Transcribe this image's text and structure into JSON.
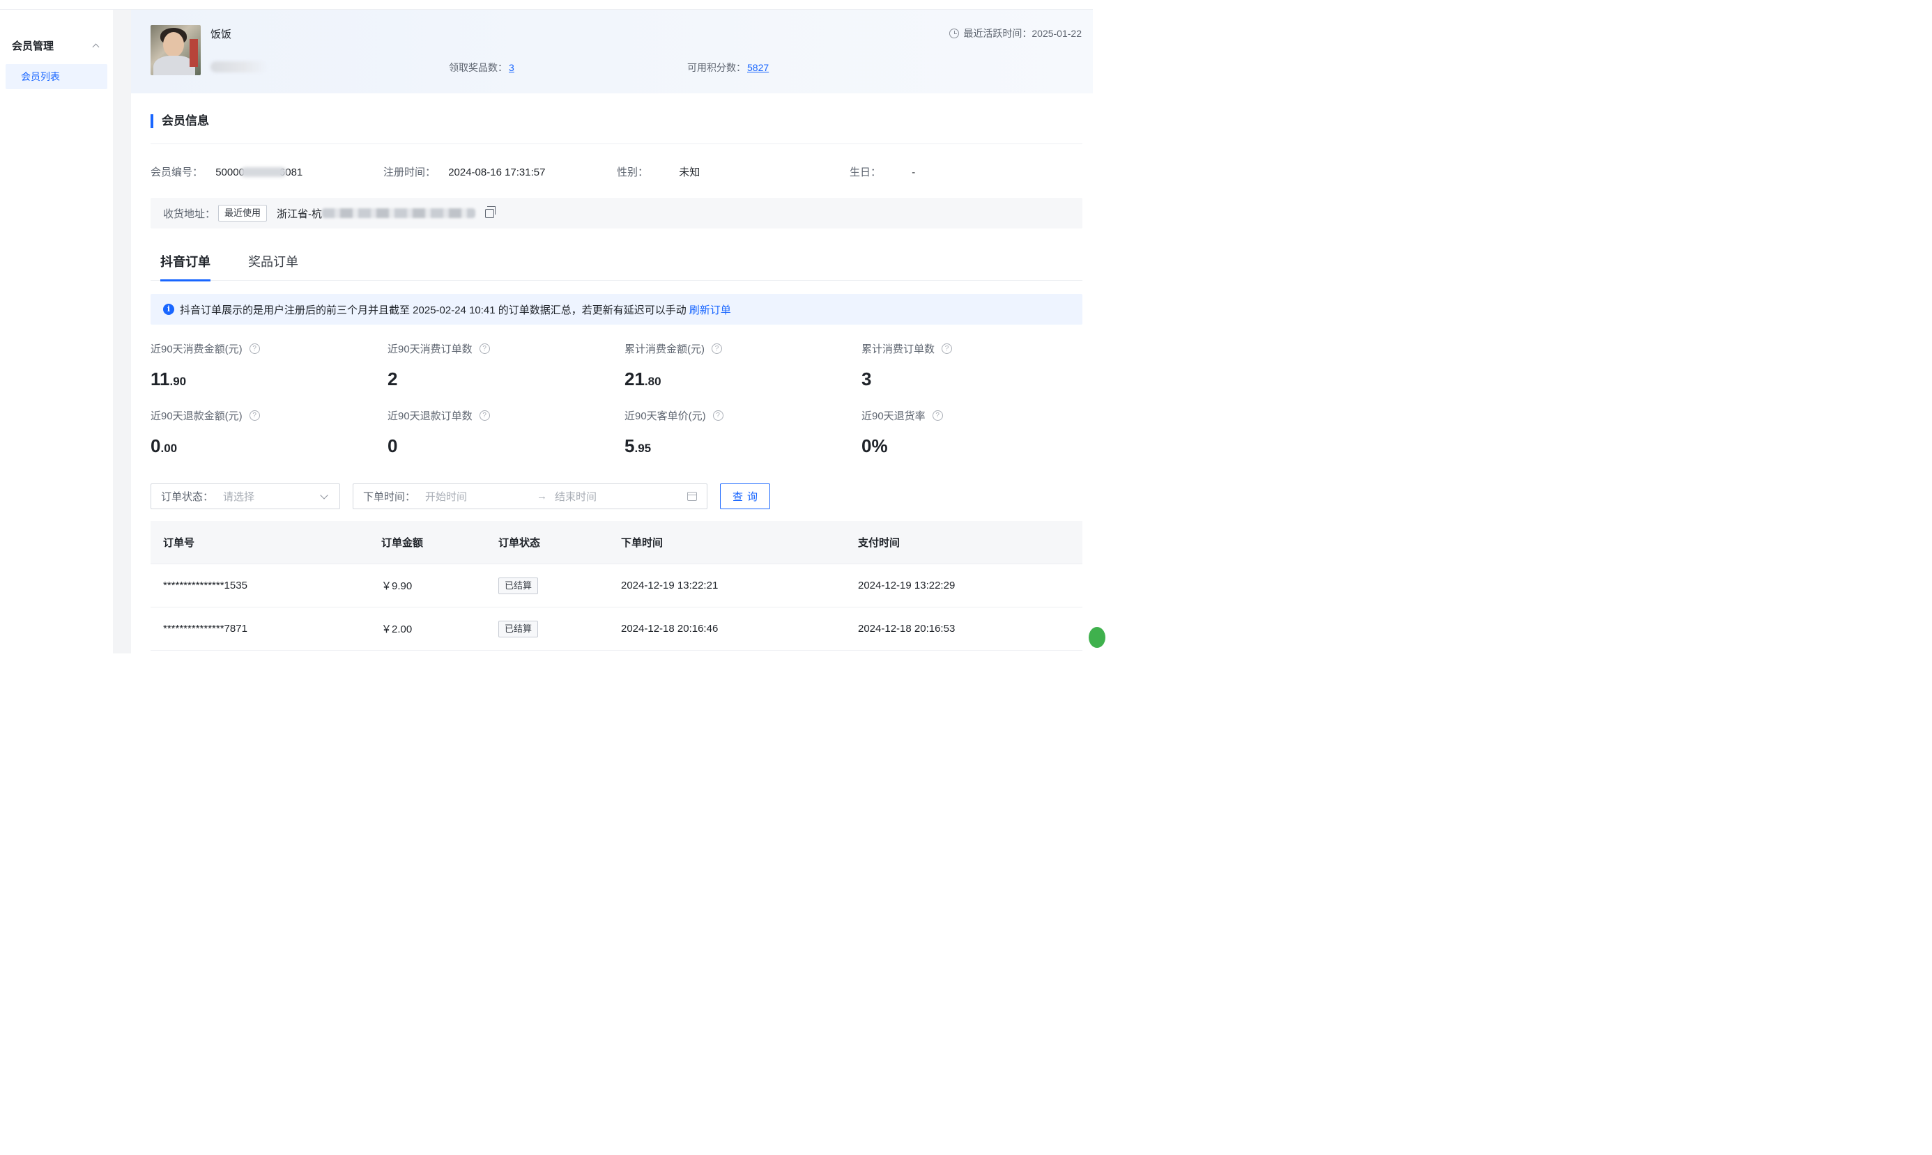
{
  "sidebar": {
    "group_label": "会员管理",
    "items": [
      {
        "label": "会员列表",
        "active": true
      }
    ]
  },
  "member_header": {
    "nickname": "饭饭",
    "prize_count_label": "领取奖品数：",
    "prize_count": "3",
    "points_label": "可用积分数：",
    "points": "5827",
    "last_active_label": "最近活跃时间：",
    "last_active": "2025-01-22"
  },
  "member_info": {
    "section_title": "会员信息",
    "id_label": "会员编号：",
    "id_prefix": "50000",
    "id_suffix": "6081",
    "reg_label": "注册时间：",
    "reg_time": "2024-08-16 17:31:57",
    "gender_label": "性别：",
    "gender": "未知",
    "birthday_label": "生日：",
    "birthday": "-",
    "address_label": "收货地址：",
    "address_tag": "最近使用",
    "address_text": "浙江省-杭"
  },
  "tabs": [
    {
      "label": "抖音订单",
      "active": true
    },
    {
      "label": "奖品订单",
      "active": false
    }
  ],
  "notice": {
    "text": "抖音订单展示的是用户注册后的前三个月并且截至 2025-02-24 10:41 的订单数据汇总，若更新有延迟可以手动",
    "link": "刷新订单"
  },
  "metrics": [
    {
      "label": "近90天消费金额(元)",
      "int": "11",
      "dec": ".90"
    },
    {
      "label": "近90天消费订单数",
      "int": "2",
      "dec": ""
    },
    {
      "label": "累计消费金额(元)",
      "int": "21",
      "dec": ".80"
    },
    {
      "label": "累计消费订单数",
      "int": "3",
      "dec": ""
    },
    {
      "label": "近90天退款金额(元)",
      "int": "0",
      "dec": ".00"
    },
    {
      "label": "近90天退款订单数",
      "int": "0",
      "dec": ""
    },
    {
      "label": "近90天客单价(元)",
      "int": "5",
      "dec": ".95"
    },
    {
      "label": "近90天退货率",
      "int": "0%",
      "dec": ""
    }
  ],
  "filters": {
    "status_label": "订单状态：",
    "status_placeholder": "请选择",
    "date_label": "下单时间：",
    "start_placeholder": "开始时间",
    "end_placeholder": "结束时间",
    "query_button": "查询"
  },
  "table": {
    "columns": [
      "订单号",
      "订单金额",
      "订单状态",
      "下单时间",
      "支付时间"
    ],
    "rows": [
      {
        "order_no": "***************1535",
        "amount": "￥9.90",
        "status": "已结算",
        "order_time": "2024-12-19 13:22:21",
        "pay_time": "2024-12-19 13:22:29"
      },
      {
        "order_no": "***************7871",
        "amount": "￥2.00",
        "status": "已结算",
        "order_time": "2024-12-18 20:16:46",
        "pay_time": "2024-12-18 20:16:53"
      }
    ]
  },
  "colors": {
    "accent": "#1966ff",
    "text": "#1f2329",
    "muted": "#5e6570"
  },
  "icons": [
    "chevron-up-icon",
    "clock-icon",
    "copy-icon",
    "info-icon",
    "question-icon",
    "chevron-down-icon",
    "calendar-icon"
  ]
}
